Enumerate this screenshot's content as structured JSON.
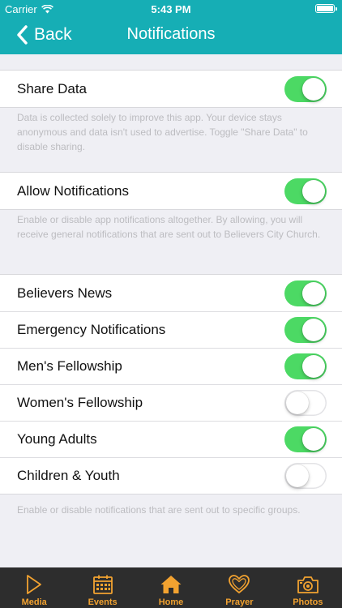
{
  "status_bar": {
    "carrier": "Carrier",
    "time": "5:43 PM"
  },
  "nav": {
    "back_label": "Back",
    "title": "Notifications",
    "color": "#16aeb5"
  },
  "share_data": {
    "label": "Share Data",
    "enabled": true,
    "note": "Data is collected solely to improve this app. Your device stays anonymous and data isn't used to advertise. Toggle \"Share Data\" to disable sharing."
  },
  "allow_notifications": {
    "label": "Allow Notifications",
    "enabled": true,
    "note": "Enable or disable app notifications altogether. By allowing, you will receive general notifications that are sent out to Believers City Church."
  },
  "groups": {
    "items": [
      {
        "label": "Believers News",
        "enabled": true
      },
      {
        "label": "Emergency Notifications",
        "enabled": true
      },
      {
        "label": "Men's Fellowship",
        "enabled": true
      },
      {
        "label": "Women's Fellowship",
        "enabled": false
      },
      {
        "label": "Young Adults",
        "enabled": true
      },
      {
        "label": "Children & Youth",
        "enabled": false
      }
    ],
    "note": "Enable or disable notifications that are sent out to specific groups."
  },
  "tabbar": {
    "accent": "#f2a230",
    "tabs": [
      {
        "label": "Media",
        "icon": "play-icon"
      },
      {
        "label": "Events",
        "icon": "calendar-icon"
      },
      {
        "label": "Home",
        "icon": "home-icon"
      },
      {
        "label": "Prayer",
        "icon": "heart-icon"
      },
      {
        "label": "Photos",
        "icon": "camera-icon"
      }
    ]
  },
  "colors": {
    "toggle_on": "#4cd964",
    "background": "#efeff4"
  }
}
